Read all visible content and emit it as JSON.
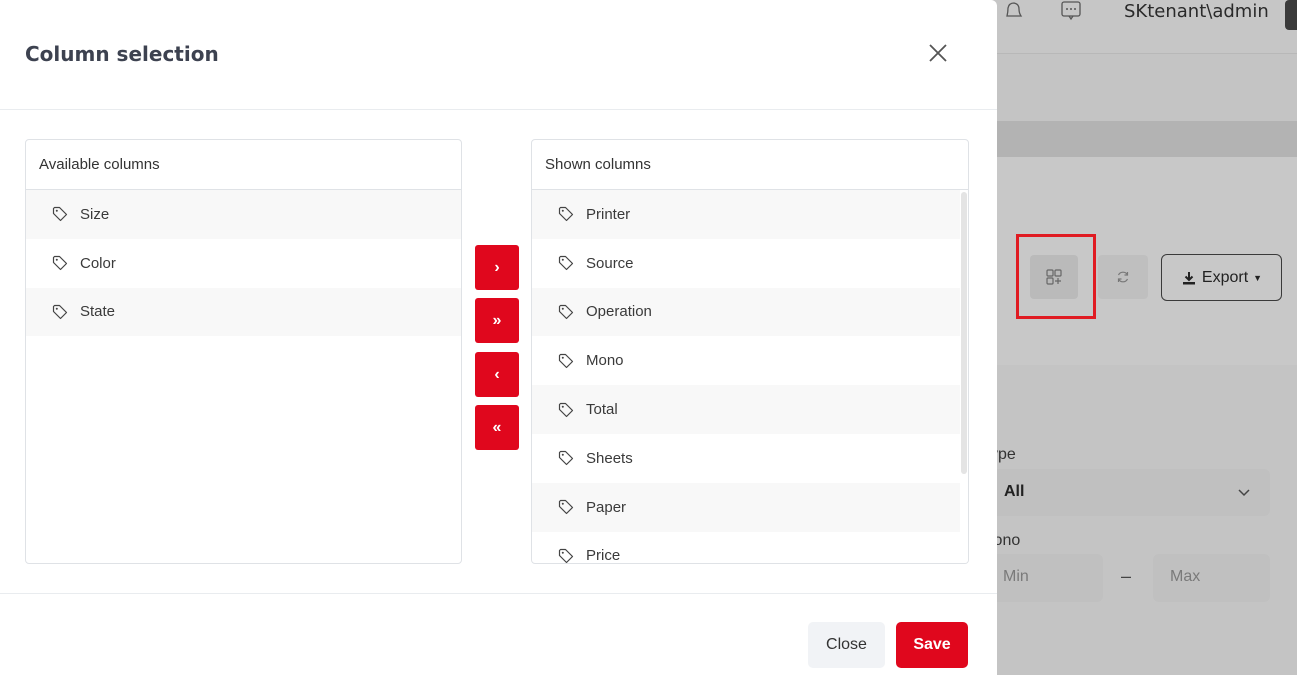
{
  "background": {
    "user": "SKtenant\\admin",
    "export_label": "Export",
    "type_label": "ype",
    "type_value": "All",
    "mono_label": "lono",
    "min_placeholder": "Min",
    "range_separator": "–",
    "max_placeholder": "Max"
  },
  "modal": {
    "title": "Column selection",
    "available": {
      "header": "Available columns",
      "items": [
        "Size",
        "Color",
        "State"
      ]
    },
    "shown": {
      "header": "Shown columns",
      "items": [
        "Printer",
        "Source",
        "Operation",
        "Mono",
        "Total",
        "Sheets",
        "Paper",
        "Price"
      ]
    },
    "move_buttons": {
      "right": "›",
      "all_right": "»",
      "left": "‹",
      "all_left": "«"
    },
    "footer": {
      "close_label": "Close",
      "save_label": "Save"
    }
  },
  "colors": {
    "accent": "#e0071d",
    "highlight": "#e01b22"
  }
}
